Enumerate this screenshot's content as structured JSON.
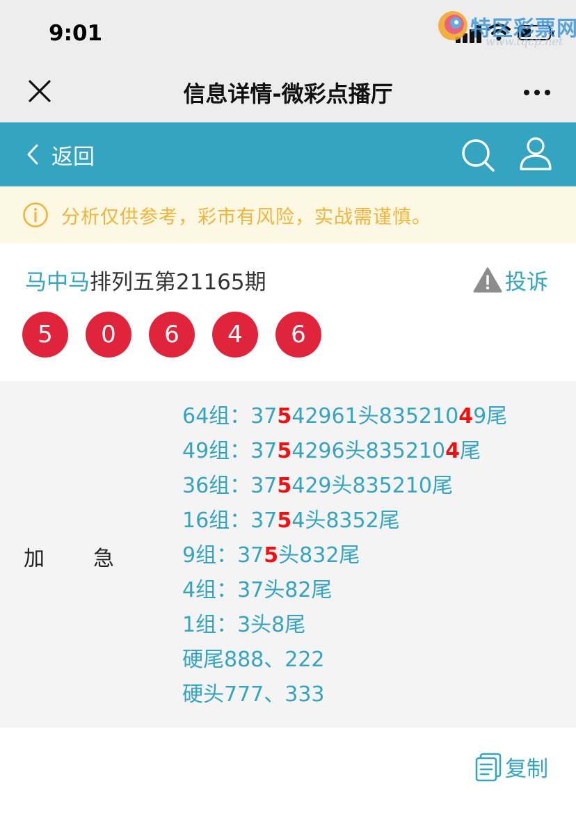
{
  "status": {
    "time": "9:01"
  },
  "watermark": {
    "text": "特区彩票网",
    "url": "www.tqcp.net"
  },
  "wechat_header": {
    "title": "信息详情-微彩点播厅"
  },
  "nav": {
    "back_label": "返回"
  },
  "warning": {
    "text": "分析仅供参考，彩市有风险，实战需谨慎。"
  },
  "post": {
    "author": "马中马",
    "title": "排列五第21165期",
    "complain_label": "投诉",
    "balls": [
      "5",
      "0",
      "6",
      "4",
      "6"
    ]
  },
  "content": {
    "label_a": "加",
    "label_b": "急",
    "lines": [
      [
        "64组：37",
        "5",
        "42961头83521",
        "0",
        "",
        "4",
        "9尾"
      ],
      [
        "49组：37",
        "5",
        "4296头835210",
        "4",
        "尾"
      ],
      [
        "36组：37",
        "5",
        "429头835210尾"
      ],
      [
        "16组：37",
        "5",
        "4头8352尾"
      ],
      [
        "9组：37",
        "5",
        "头832尾"
      ],
      [
        "4组：37头82尾"
      ],
      [
        "1组：3头8尾"
      ],
      [
        "硬尾888、222"
      ],
      [
        "硬头777、333"
      ]
    ]
  },
  "copy": {
    "label": "复制"
  },
  "colors": {
    "teal": "#34a4c0",
    "ball_red": "#e0243b",
    "highlight": "#ee1111",
    "warning_text": "#f0b43c"
  }
}
